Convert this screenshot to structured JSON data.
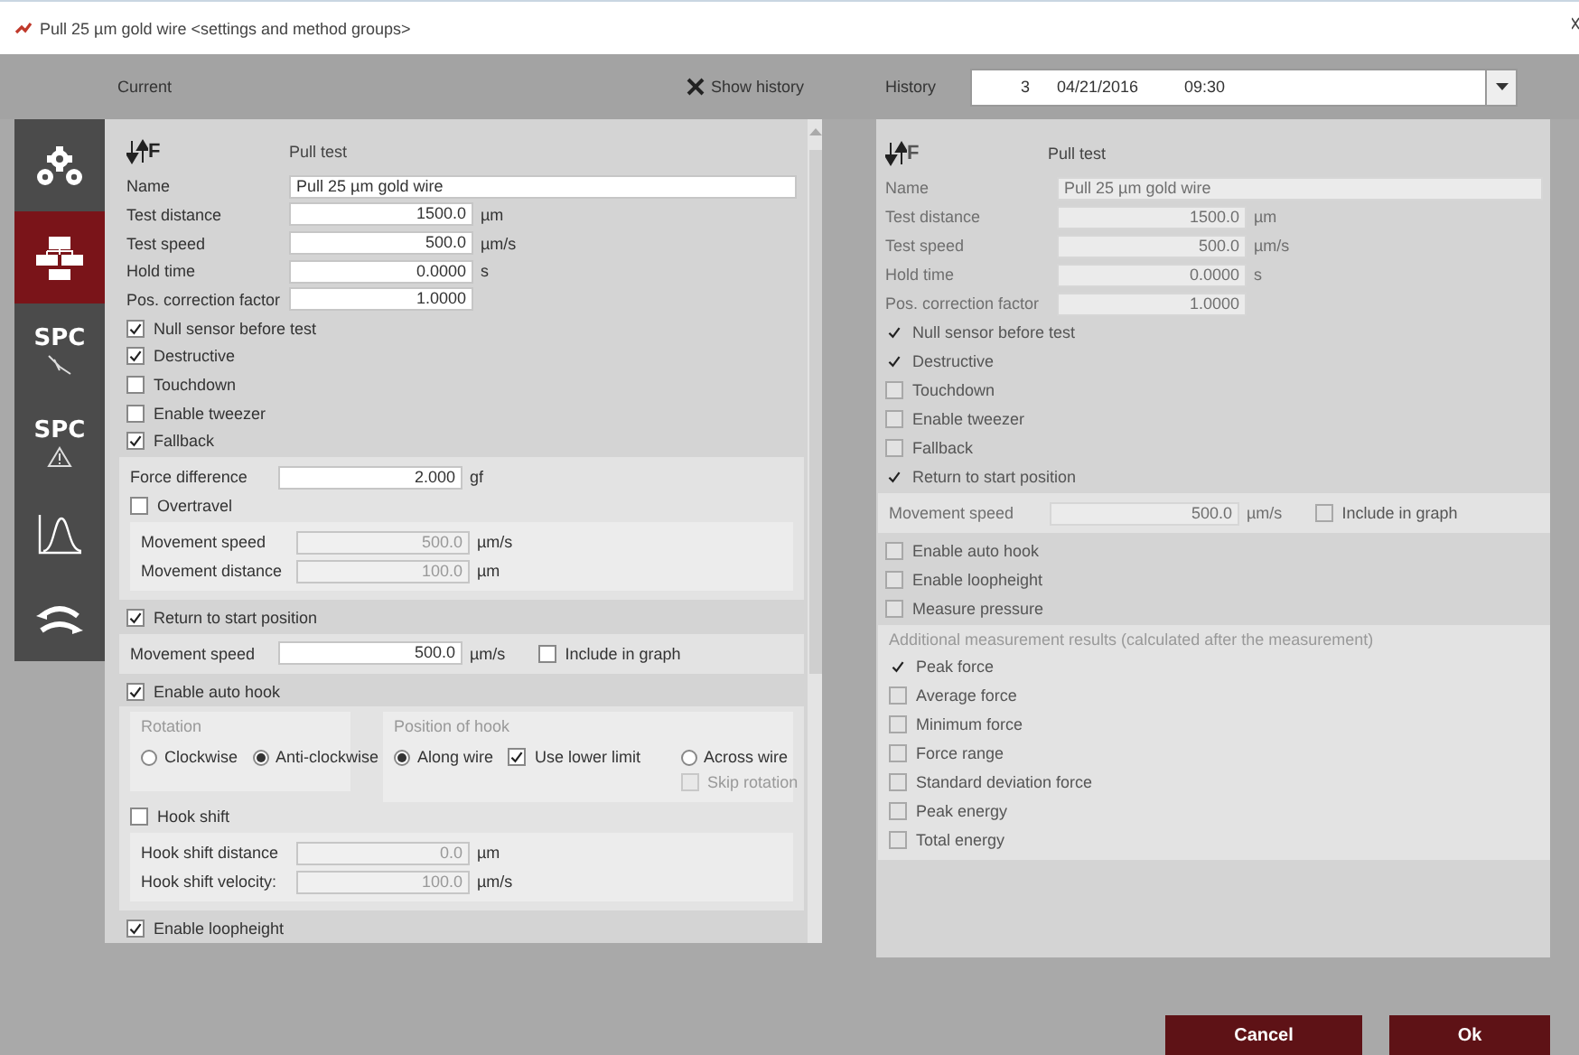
{
  "window": {
    "title": "Pull 25 µm gold wire <settings and method groups>"
  },
  "header": {
    "current_label": "Current",
    "show_history": {
      "label": "Show history",
      "checked": true
    },
    "history_label": "History",
    "history_entry": [
      "3",
      "04/21/2016",
      "09:30"
    ]
  },
  "sidebar": [
    {
      "kind": "settings",
      "selected": false
    },
    {
      "kind": "method",
      "selected": true
    },
    {
      "kind": "spc-wire",
      "text": "SPC",
      "selected": false
    },
    {
      "kind": "spc-alert",
      "text": "SPC",
      "selected": false
    },
    {
      "kind": "distribution",
      "selected": false
    },
    {
      "kind": "exchange",
      "selected": false
    }
  ],
  "current": {
    "disabled": false,
    "heading": {
      "symbol": "F",
      "label": "Pull test"
    },
    "rows": [
      {
        "kind": "field",
        "label": "Name",
        "value": "Pull 25 µm gold wire",
        "wide": true,
        "disabled": false
      },
      {
        "kind": "field",
        "label": "Test distance",
        "value": "1500.0",
        "unit": "µm",
        "disabled": false
      },
      {
        "kind": "field",
        "label": "Test speed",
        "value": "500.0",
        "unit": "µm/s",
        "disabled": false
      },
      {
        "kind": "field",
        "label": "Hold time",
        "value": "0.0000",
        "unit": "s",
        "disabled": false
      },
      {
        "kind": "field",
        "label": "Pos. correction factor",
        "value": "1.0000",
        "disabled": false
      },
      {
        "kind": "check",
        "label": "Null sensor before test",
        "checked": true,
        "disabled": false
      },
      {
        "kind": "check",
        "label": "Destructive",
        "checked": true,
        "disabled": false
      },
      {
        "kind": "check",
        "label": "Touchdown",
        "checked": false,
        "disabled": false
      },
      {
        "kind": "check",
        "label": "Enable tweezer",
        "checked": false,
        "disabled": false
      },
      {
        "kind": "check",
        "label": "Fallback",
        "checked": true,
        "disabled": false
      },
      {
        "kind": "group",
        "rows": [
          {
            "kind": "field",
            "label": "Force difference",
            "value": "2.000",
            "unit": "gf",
            "disabled": false
          },
          {
            "kind": "check",
            "label": "Overtravel",
            "checked": false,
            "disabled": false
          },
          {
            "kind": "group",
            "rows": [
              {
                "kind": "field",
                "label": "Movement speed",
                "value": "500.0",
                "unit": "µm/s",
                "disabled": true
              },
              {
                "kind": "field",
                "label": "Movement distance",
                "value": "100.0",
                "unit": "µm",
                "disabled": true
              }
            ]
          }
        ]
      },
      {
        "kind": "check",
        "label": "Return to start position",
        "checked": true,
        "disabled": false
      },
      {
        "kind": "group",
        "rows": [
          {
            "kind": "line",
            "items": [
              {
                "kind": "field",
                "label": "Movement speed",
                "value": "500.0",
                "unit": "µm/s",
                "disabled": false
              },
              {
                "kind": "check",
                "label": "Include in graph",
                "checked": false,
                "disabled": false
              }
            ]
          }
        ]
      },
      {
        "kind": "check",
        "label": "Enable auto hook",
        "checked": true,
        "disabled": false
      },
      {
        "kind": "group",
        "rows": [
          {
            "kind": "line",
            "items": [
              {
                "kind": "frame",
                "title": "Rotation",
                "rows": [
                  {
                    "kind": "line",
                    "items": [
                      {
                        "kind": "radio",
                        "label": "Clockwise",
                        "selected": false
                      },
                      {
                        "kind": "radio",
                        "label": "Anti-clockwise",
                        "selected": true
                      }
                    ]
                  }
                ]
              },
              {
                "kind": "frame",
                "title": "Position of hook",
                "rows": [
                  {
                    "kind": "line",
                    "items": [
                      {
                        "kind": "radio",
                        "label": "Along wire",
                        "selected": true
                      },
                      {
                        "kind": "check",
                        "label": "Use lower limit",
                        "checked": true,
                        "disabled": false
                      },
                      {
                        "kind": "stack",
                        "rows": [
                          {
                            "kind": "radio",
                            "label": "Across wire",
                            "selected": false
                          },
                          {
                            "kind": "check",
                            "label": "Skip rotation",
                            "checked": false,
                            "disabled": true
                          }
                        ]
                      }
                    ]
                  }
                ]
              }
            ]
          },
          {
            "kind": "check",
            "label": "Hook shift",
            "checked": false,
            "disabled": false
          },
          {
            "kind": "group",
            "rows": [
              {
                "kind": "field",
                "label": "Hook shift distance",
                "value": "0.0",
                "unit": "µm",
                "disabled": true
              },
              {
                "kind": "field",
                "label": "Hook shift velocity:",
                "value": "100.0",
                "unit": "µm/s",
                "disabled": true
              }
            ]
          }
        ]
      },
      {
        "kind": "check",
        "label": "Enable loopheight",
        "checked": true,
        "disabled": false
      }
    ]
  },
  "history": {
    "disabled": true,
    "heading": {
      "symbol": "F",
      "label": "Pull test"
    },
    "rows": [
      {
        "kind": "field",
        "label": "Name",
        "value": "Pull 25 µm gold wire",
        "wide": true
      },
      {
        "kind": "field",
        "label": "Test distance",
        "value": "1500.0",
        "unit": "µm"
      },
      {
        "kind": "field",
        "label": "Test speed",
        "value": "500.0",
        "unit": "µm/s"
      },
      {
        "kind": "field",
        "label": "Hold time",
        "value": "0.0000",
        "unit": "s"
      },
      {
        "kind": "field",
        "label": "Pos. correction factor",
        "value": "1.0000"
      },
      {
        "kind": "check",
        "label": "Null sensor before test",
        "checked": true
      },
      {
        "kind": "check",
        "label": "Destructive",
        "checked": true
      },
      {
        "kind": "check",
        "label": "Touchdown",
        "checked": false
      },
      {
        "kind": "check",
        "label": "Enable tweezer",
        "checked": false
      },
      {
        "kind": "check",
        "label": "Fallback",
        "checked": false
      },
      {
        "kind": "check",
        "label": "Return to start position",
        "checked": true
      },
      {
        "kind": "group",
        "rows": [
          {
            "kind": "line",
            "items": [
              {
                "kind": "field",
                "label": "Movement speed",
                "value": "500.0",
                "unit": "µm/s"
              },
              {
                "kind": "check",
                "label": "Include in graph",
                "checked": false
              }
            ]
          }
        ]
      },
      {
        "kind": "check",
        "label": "Enable auto hook",
        "checked": false
      },
      {
        "kind": "check",
        "label": "Enable loopheight",
        "checked": false
      },
      {
        "kind": "check",
        "label": "Measure pressure",
        "checked": false
      },
      {
        "kind": "group",
        "title": "Additional measurement results (calculated after the measurement)",
        "rows": [
          {
            "kind": "check",
            "label": "Peak force",
            "checked": true
          },
          {
            "kind": "check",
            "label": "Average force",
            "checked": false
          },
          {
            "kind": "check",
            "label": "Minimum force",
            "checked": false
          },
          {
            "kind": "check",
            "label": "Force range",
            "checked": false
          },
          {
            "kind": "check",
            "label": "Standard deviation force",
            "checked": false
          },
          {
            "kind": "check",
            "label": "Peak energy",
            "checked": false
          },
          {
            "kind": "check",
            "label": "Total energy",
            "checked": false
          }
        ]
      }
    ]
  },
  "buttons": [
    {
      "label": "Cancel"
    },
    {
      "label": "Ok"
    }
  ]
}
